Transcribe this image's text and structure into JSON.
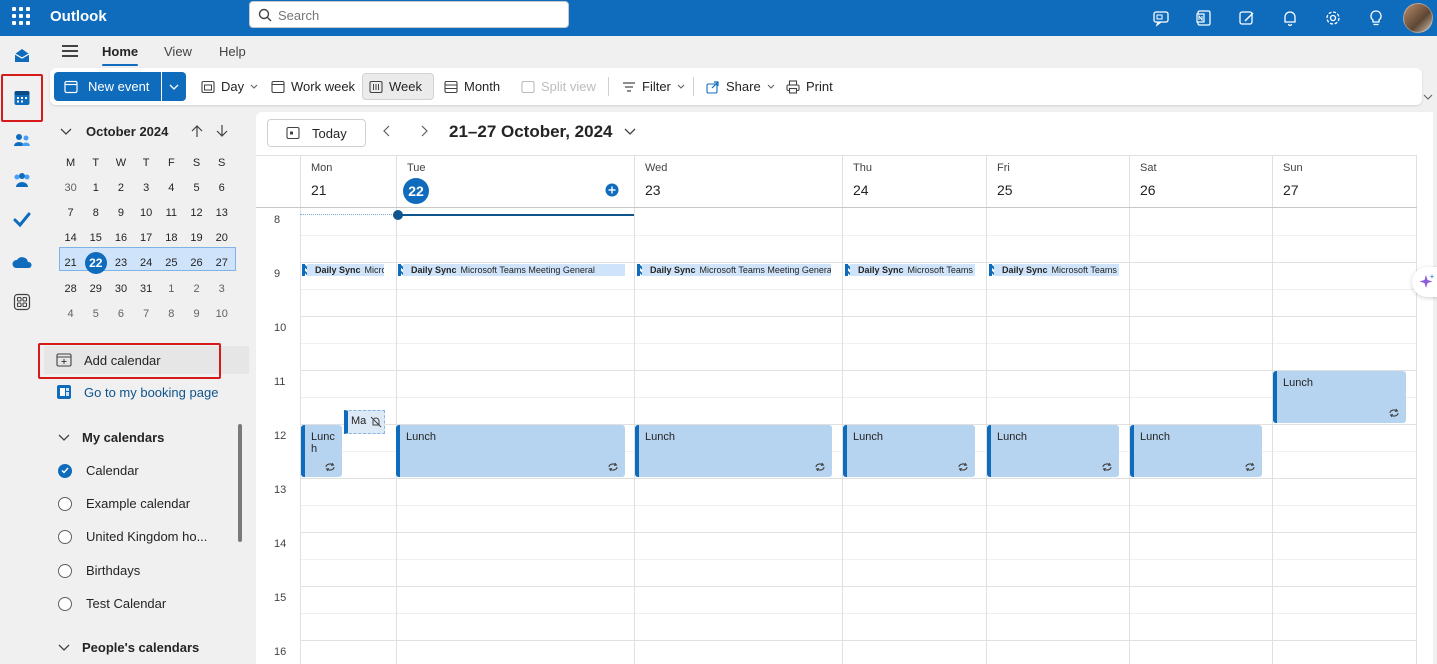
{
  "app": {
    "name": "Outlook",
    "search_placeholder": "Search"
  },
  "ribbon": {
    "tabs": [
      "Home",
      "View",
      "Help"
    ],
    "new_event": "New event",
    "day": "Day",
    "work_week": "Work week",
    "week": "Week",
    "month": "Month",
    "split_view": "Split view",
    "filter": "Filter",
    "share": "Share",
    "print": "Print"
  },
  "mini_calendar": {
    "title": "October 2024",
    "days_of_week": [
      "M",
      "T",
      "W",
      "T",
      "F",
      "S",
      "S"
    ],
    "weeks": [
      [
        "30",
        "1",
        "2",
        "3",
        "4",
        "5",
        "6"
      ],
      [
        "7",
        "8",
        "9",
        "10",
        "11",
        "12",
        "13"
      ],
      [
        "14",
        "15",
        "16",
        "17",
        "18",
        "19",
        "20"
      ],
      [
        "21",
        "22",
        "23",
        "24",
        "25",
        "26",
        "27"
      ],
      [
        "28",
        "29",
        "30",
        "31",
        "1",
        "2",
        "3"
      ],
      [
        "4",
        "5",
        "6",
        "7",
        "8",
        "9",
        "10"
      ]
    ],
    "today": "22"
  },
  "left_panel": {
    "add_calendar": "Add calendar",
    "booking_page": "Go to my booking page",
    "my_calendars_label": "My calendars",
    "calendars": [
      {
        "name": "Calendar",
        "checked": true
      },
      {
        "name": "Example calendar",
        "checked": false
      },
      {
        "name": "United Kingdom ho...",
        "checked": false
      },
      {
        "name": "Birthdays",
        "checked": false
      },
      {
        "name": "Test Calendar",
        "checked": false
      }
    ],
    "peoples_calendars_label": "People's calendars"
  },
  "calendar": {
    "today_label": "Today",
    "range_title": "21–27 October, 2024",
    "days": [
      {
        "dow": "Mon",
        "num": "21"
      },
      {
        "dow": "Tue",
        "num": "22",
        "today": true
      },
      {
        "dow": "Wed",
        "num": "23"
      },
      {
        "dow": "Thu",
        "num": "24"
      },
      {
        "dow": "Fri",
        "num": "25"
      },
      {
        "dow": "Sat",
        "num": "26"
      },
      {
        "dow": "Sun",
        "num": "27"
      }
    ],
    "hours": [
      "8",
      "9",
      "10",
      "11",
      "12",
      "13",
      "14",
      "15",
      "16"
    ],
    "events": {
      "sync_mon": {
        "title": "Daily Sync",
        "detail": "Micros"
      },
      "sync_tue": {
        "title": "Daily Sync",
        "detail": "Microsoft Teams Meeting  General"
      },
      "sync_wed": {
        "title": "Daily Sync",
        "detail": "Microsoft Teams Meeting  General"
      },
      "sync_thu": {
        "title": "Daily Sync",
        "detail": "Microsoft Teams M"
      },
      "sync_fri": {
        "title": "Daily Sync",
        "detail": "Microsoft Teams M"
      },
      "lunch_mon": "Lunch",
      "lunch_tue": "Lunch",
      "lunch_wed": "Lunch",
      "lunch_thu": "Lunch",
      "lunch_fri": "Lunch",
      "lunch_sat": "Lunch",
      "lunch_sun": "Lunch",
      "ma": "Ma"
    }
  },
  "colors": {
    "brand": "#0f6cbd",
    "event_fill": "#b6d4f0",
    "highlight": "#d61a1a"
  }
}
